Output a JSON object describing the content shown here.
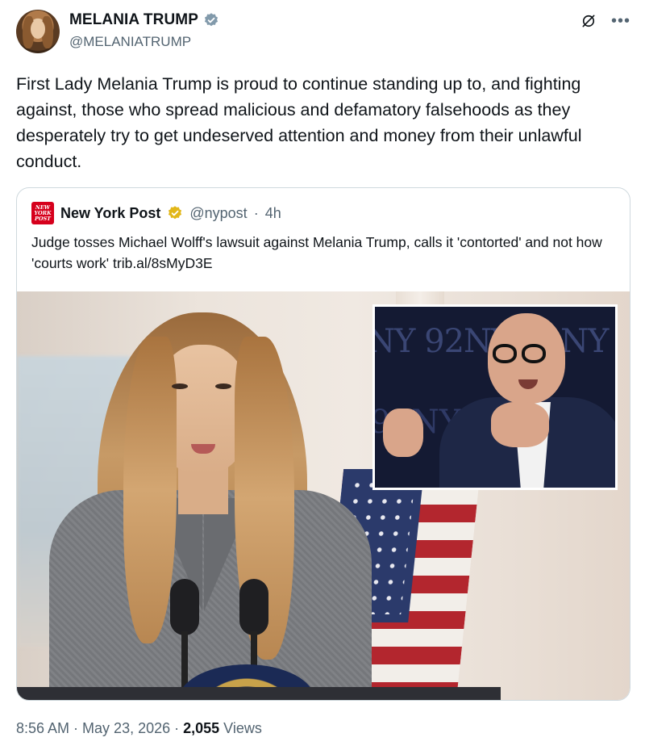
{
  "author": {
    "display_name": "MELANIA TRUMP",
    "handle": "@MELANIATRUMP",
    "verified_color": "#829aab"
  },
  "tweet": {
    "text": "First Lady Melania Trump is proud to continue standing up to, and fighting against, those who spread malicious and defamatory falsehoods as they desperately try to get undeserved attention and money from their unlawful conduct."
  },
  "quote": {
    "logo_text": "NEW YORK POST",
    "name": "New York Post",
    "handle": "@nypost",
    "separator": "·",
    "time": "4h",
    "text": "Judge tosses Michael Wolff's lawsuit against Melania Trump, calls it 'contorted' and not how 'courts work' trib.al/8sMyD3E",
    "badge_color": "#e2b719",
    "inset_backdrop_1": "NY 92NY 92NY 92",
    "inset_backdrop_2": "92NY"
  },
  "meta": {
    "time": "8:56 AM",
    "sep1": " · ",
    "date": "May 23, 2026",
    "sep2": " · ",
    "views_count": "2,055",
    "views_label": " Views"
  },
  "icons": {
    "grok": "grok-icon",
    "more": "more-icon",
    "verified": "verified-badge-icon"
  }
}
